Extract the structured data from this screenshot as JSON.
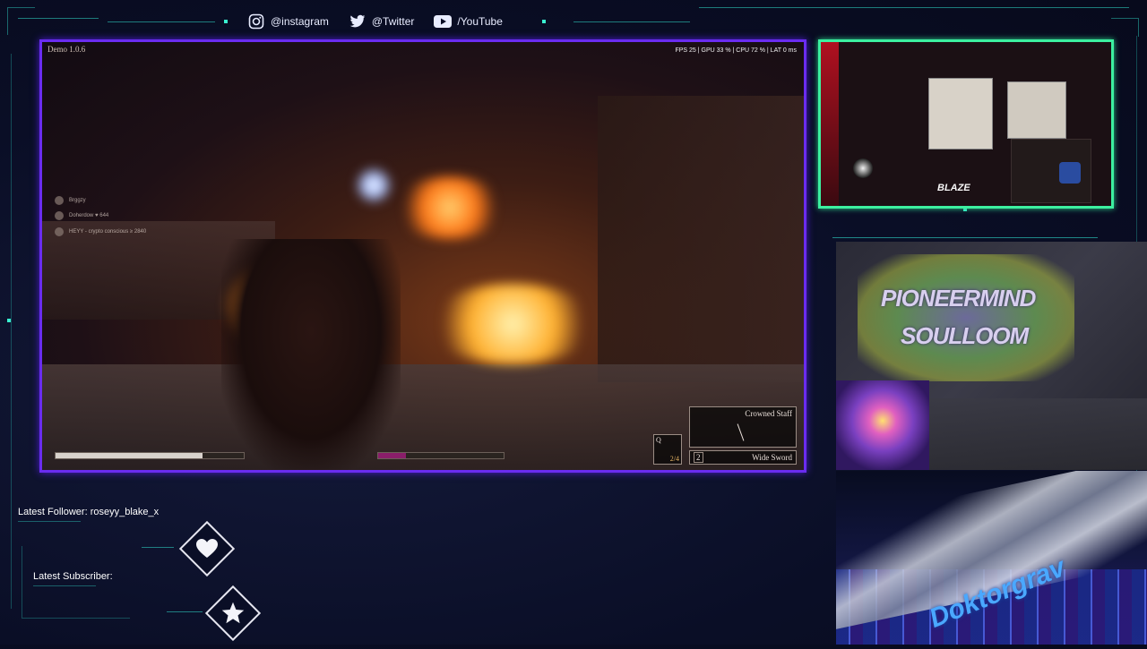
{
  "social": {
    "instagram": "@instagram",
    "twitter": "@Twitter",
    "youtube": "/YouTube"
  },
  "game": {
    "version": "Demo 1.0.6",
    "stats": "FPS  25   |  GPU 33 %  |  CPU 72 %  |  LAT 0 ms",
    "feed": [
      "Brggzy",
      "Doherdow   ♥ 644",
      "HEYY - crypto conscious   ≥ 2840"
    ],
    "health_fraction": 0.78,
    "stamina_fraction": 0.22,
    "quick_slot_key": "Q",
    "quick_slot_count": "2/4",
    "weapon_top": "Crowned Staff",
    "weapon_slot_key": "2",
    "weapon_bottom": "Wide Sword"
  },
  "webcam": {
    "brand": "BLAZE"
  },
  "art": {
    "line1": "PIONEERMIND",
    "line2": "SOULLOOM",
    "banner": "Doktorgrav"
  },
  "alerts": {
    "follower_label": "Latest Follower: roseyy_blake_x",
    "subscriber_label": "Latest Subscriber:"
  },
  "icons": {
    "follower": "heart-icon",
    "subscriber": "star-icon"
  },
  "colors": {
    "game_border": "#6a2cf0",
    "cam_border": "#3cf0a0",
    "accent": "#2fd9c9"
  }
}
